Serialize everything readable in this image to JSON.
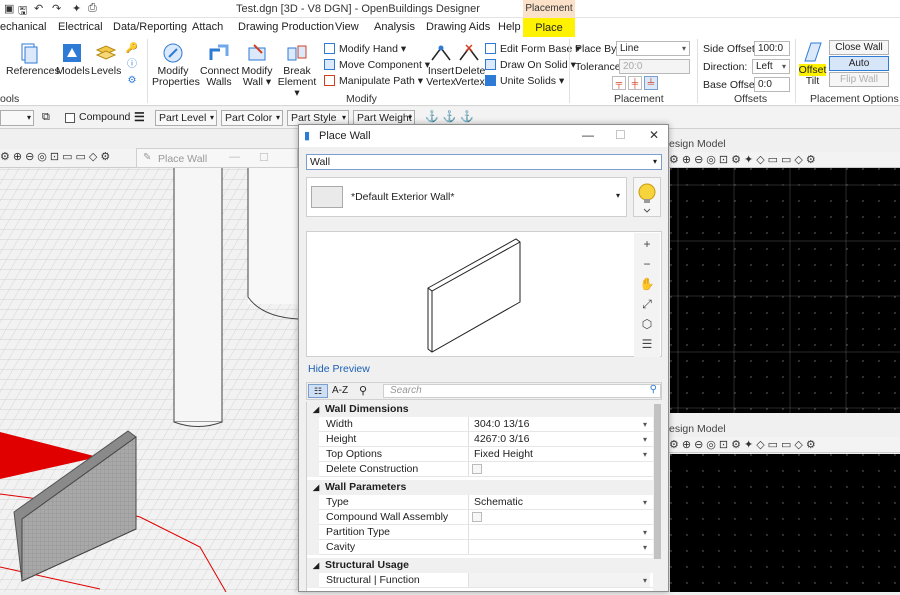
{
  "app_title": "Test.dgn [3D - V8 DGN] - OpenBuildings Designer",
  "context_tab_group": "Placement",
  "menu_tabs": [
    "echanical",
    "Electrical",
    "Data/Reporting",
    "Attach",
    "Drawing Production",
    "View",
    "Analysis",
    "Drawing Aids",
    "Help"
  ],
  "active_tab": "Place",
  "ribbon": {
    "references": "References",
    "models": "Models",
    "levels": "Levels",
    "group_tools": "ools",
    "modify_properties": [
      "Modify",
      "Properties"
    ],
    "connect_walls": [
      "Connect",
      "Walls"
    ],
    "modify_wall": [
      "Modify",
      "Wall"
    ],
    "break_element": [
      "Break",
      "Element"
    ],
    "modify_hand": "Modify Hand",
    "move_component": "Move Component",
    "manipulate_path": "Manipulate Path",
    "insert_vertex": [
      "Insert",
      "Vertex"
    ],
    "delete_vertex": [
      "Delete",
      "Vertex"
    ],
    "edit_form_base": "Edit Form Base",
    "draw_on_solid": "Draw On Solid",
    "unite_solids": "Unite Solids",
    "group_modify": "Modify",
    "place_by_label": "Place By:",
    "place_by_value": "Line",
    "tolerance_label": "Tolerance:",
    "tolerance_value": "20:0",
    "group_placement": "Placement",
    "side_offset_label": "Side Offset:",
    "side_offset_value": "100:0",
    "direction_label": "Direction:",
    "direction_value": "Left",
    "base_offset_label": "Base Offset:",
    "base_offset_value": "0:0",
    "group_offsets": "Offsets",
    "offset": "Offset",
    "tilt": "Tilt",
    "close_wall": "Close Wall",
    "auto_connect": "Auto Connect",
    "flip_wall": "Flip Wall",
    "group_placement_options": "Placement Options"
  },
  "toolbar2": {
    "compound": "Compound",
    "part_level": "Part Level",
    "part_color": "Part Color",
    "part_style": "Part Style",
    "part_weight": "Part Weight"
  },
  "ghost_window_title": "Place Wall",
  "view_titles": [
    "esign Model",
    "esign Model"
  ],
  "dialog": {
    "title": "Place Wall",
    "type": "Wall",
    "style": "*Default Exterior Wall*",
    "hide_preview": "Hide Preview",
    "sort_az": "A-Z",
    "search_placeholder": "Search",
    "categories": [
      {
        "name": "Wall Dimensions",
        "rows": [
          {
            "k": "Width",
            "v": "304:0 13/16",
            "dd": true
          },
          {
            "k": "Height",
            "v": "4267:0 3/16",
            "dd": true
          },
          {
            "k": "Top Options",
            "v": "Fixed Height",
            "dd": true
          },
          {
            "k": "Delete Construction",
            "v": "",
            "cb": true
          }
        ]
      },
      {
        "name": "Wall Parameters",
        "rows": [
          {
            "k": "Type",
            "v": "Schematic",
            "dd": true
          },
          {
            "k": "Compound Wall Assembly",
            "v": "",
            "cb": true
          },
          {
            "k": "Partition Type",
            "v": "",
            "dd": true
          },
          {
            "k": "Cavity",
            "v": "",
            "dd": true
          }
        ]
      },
      {
        "name": "Structural Usage",
        "rows": [
          {
            "k": "Structural | Function",
            "v": "",
            "dd": true
          }
        ]
      }
    ]
  },
  "colors": {
    "highlight": "#fff200",
    "context_tab": "#fbe1c8",
    "selection_red": "#e00000",
    "link_blue": "#1a5fb4"
  }
}
